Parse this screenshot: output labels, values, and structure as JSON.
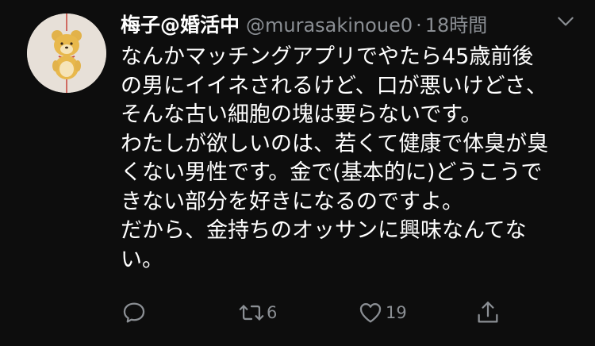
{
  "tweet": {
    "display_name": "梅子@婚活中",
    "handle": "@murasakinoue0",
    "separator": "·",
    "time": "18時間",
    "body_lines": [
      "なんかマッチングアプリでやたら45歳前後",
      "の男にイイネされるけど、口が悪いけどさ、",
      "そんな古い細胞の塊は要らないです。",
      "わたしが欲しいのは、若くて健康で体臭が臭",
      "くない男性です。金で(基本的に)どうこうで",
      "きない部分を好きになるのですよ。",
      "だから、金持ちのオッサンに興味なんてな",
      "い。"
    ],
    "actions": {
      "reply_count": "",
      "retweet_count": "6",
      "like_count": "19"
    }
  },
  "colors": {
    "background": "#0d0d0d",
    "text": "#ffffff",
    "muted": "#8b8f94"
  },
  "icons": {
    "avatar": "yellow-bear-avatar",
    "more": "chevron-down-icon",
    "reply": "reply-icon",
    "retweet": "retweet-icon",
    "like": "heart-icon",
    "share": "share-icon"
  }
}
